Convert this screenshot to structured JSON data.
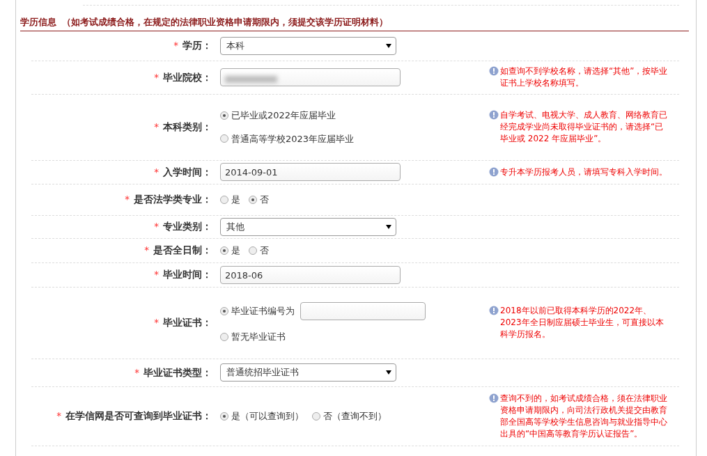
{
  "section": {
    "title": "学历信息",
    "note": "（如考试成绩合格，在规定的法律职业资格申请期限内，须提交该学历证明材料）"
  },
  "rows": [
    {
      "marker": "*",
      "label": "学历：",
      "kind": "select",
      "value": "本科"
    },
    {
      "marker": "*",
      "label": "毕业院校：",
      "kind": "text",
      "blurred": true,
      "hint": "如查询不到学校名称，请选择“其他”，按毕业证书上学校名称填写。"
    },
    {
      "marker": "*",
      "label": "本科类别：",
      "kind": "radio-stacked",
      "options": [
        {
          "label": "已毕业或2022年应届毕业",
          "selected": true
        },
        {
          "label": "普通高等学校2023年应届毕业",
          "selected": false
        }
      ],
      "hint": "自学考试、电视大学、成人教育、网络教育已经完成学业尚未取得毕业证书的，请选择“已毕业或 2022 年应届毕业”。"
    },
    {
      "marker": "*",
      "label": "入学时间：",
      "kind": "text",
      "value": "2014-09-01",
      "hint": "专升本学历报考人员，请填写专科入学时间。"
    },
    {
      "marker": "*",
      "label": "是否法学类专业：",
      "kind": "radio",
      "options": [
        {
          "label": "是",
          "selected": false
        },
        {
          "label": "否",
          "selected": true
        }
      ]
    },
    {
      "marker": "*",
      "label": "专业类别：",
      "kind": "select",
      "value": "其他"
    },
    {
      "marker": "*",
      "label": "是否全日制：",
      "kind": "radio",
      "options": [
        {
          "label": "是",
          "selected": true
        },
        {
          "label": "否",
          "selected": false
        }
      ]
    },
    {
      "marker": "*",
      "label": "毕业时间：",
      "kind": "text",
      "value": "2018-06"
    },
    {
      "marker": "*",
      "label": "毕业证书：",
      "kind": "radio-stacked",
      "options": [
        {
          "label": "毕业证书编号为",
          "selected": true,
          "kind": "with-field"
        },
        {
          "label": "暂无毕业证书",
          "selected": false
        }
      ],
      "hint": "2018年以前已取得本科学历的2022年、2023年全日制应届硕士毕业生，可直接以本科学历报名。"
    },
    {
      "marker": "*",
      "label": "毕业证书类型：",
      "kind": "select",
      "value": "普通统招毕业证书"
    },
    {
      "marker": "*",
      "label": "在学信网是否可查询到毕业证书：",
      "kind": "radio",
      "options": [
        {
          "label": "是（可以查询到）",
          "selected": true
        },
        {
          "label": "否（查询不到）",
          "selected": false
        }
      ],
      "hint": "查询不到的，如考试成绩合格，须在法律职业资格申请期限内，向司法行政机关提交由教育部全国高等学校学生信息咨询与就业指导中心出具的“中国高等教育学历认证报告”。"
    }
  ]
}
